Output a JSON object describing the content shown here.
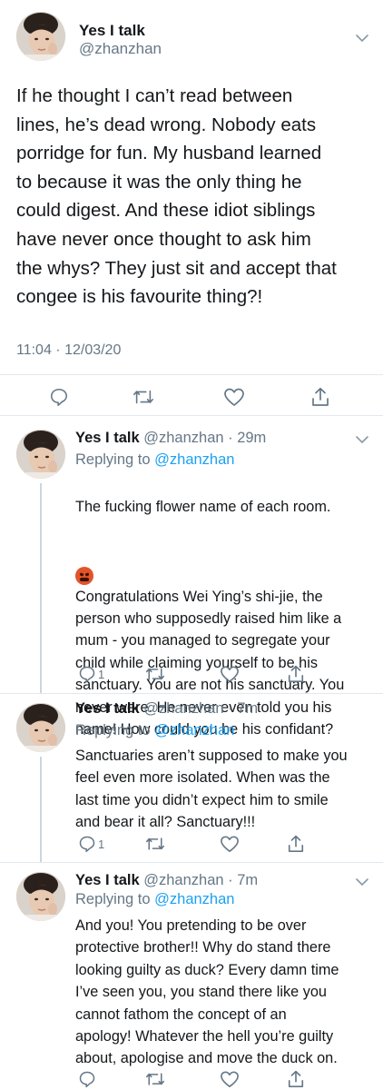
{
  "colors": {
    "text": "#14171a",
    "secondary": "#657786",
    "link": "#1da1f2",
    "divider": "#e1e8ed"
  },
  "main_tweet": {
    "name": "Yes I talk",
    "handle": "@zhanzhan",
    "text": "If he thought I can’t read between\nlines, he’s dead wrong. Nobody eats\nporridge for fun. My husband learned\nto because it was the only thing he\ncould digest. And these idiot siblings\nhave never once thought to ask him\nthe whys? They just sit and accept that\ncongee is his favourite thing?!",
    "timestamp": "11:04 · 12/03/20",
    "actions": [
      "reply-icon",
      "retweet-icon",
      "like-icon",
      "share-icon"
    ]
  },
  "replies": [
    {
      "name": "Yes I talk",
      "meta": "@zhanzhan · 29m",
      "replying_label": "Replying to",
      "replying_to": "@zhanzhan",
      "text_before_emoji": "The fucking flower name of each room.",
      "text": "Congratulations Wei Ying’s shi-jie, the\nperson who supposedly raised him like a\nmum - you managed to segregate your\nchild while claiming yourself to be his\nsanctuary. You are not his sanctuary. You\nnever were. He never even told you his\nname! How could you be his confidant?",
      "reply_count": "1"
    },
    {
      "name": "Yes I talk",
      "meta": "@zhanzhan · 7m",
      "replying_label": "Replying to",
      "replying_to": "@zhanzhan",
      "text": "Sanctuaries aren’t supposed to make you\nfeel even more isolated. When was the\nlast time you didn’t expect him to smile\nand bear it all? Sanctuary!!!",
      "reply_count": "1"
    },
    {
      "name": "Yes I talk",
      "meta": "@zhanzhan · 7m",
      "replying_label": "Replying to",
      "replying_to": "@zhanzhan",
      "text": "And you! You pretending to be over\nprotective brother!! Why do stand there\nlooking guilty as duck? Every damn time\nI’ve seen you, you stand there like you\ncannot fathom the concept of an\napology! Whatever the hell you’re guilty\nabout, apologise and move the duck on.",
      "reply_count": ""
    }
  ]
}
